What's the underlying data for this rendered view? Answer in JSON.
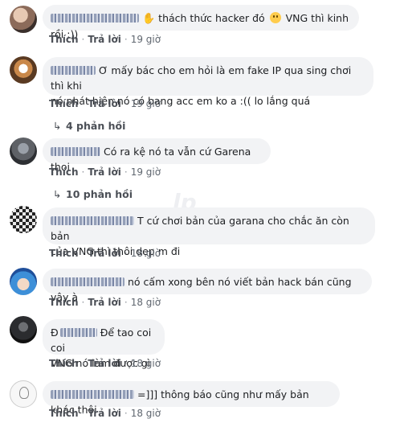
{
  "comments": [
    {
      "author_blurred": true,
      "text_before_emoji": "thách thức hacker đó",
      "text_after_emoji": "VNG thì kinh rồi :))",
      "hand_icon": "waving-hand-icon",
      "smile_icon": "slightly-smiling-face-icon",
      "like": "Thích",
      "reply": "Trả lời",
      "time": "19 giờ"
    },
    {
      "author_blurred": true,
      "line1": "Ơ mấy bác cho em hỏi là em fake IP qua sing chơi thì khi",
      "line2": "nó phát hiện nó có bang acc em ko a :(( lo lắng quá",
      "like": "Thích",
      "reply": "Trả lời",
      "time": "19 giờ",
      "replies": "4 phản hồi"
    },
    {
      "author_blurred": true,
      "line1": "Có ra kệ nó ta vẫn cứ Garena thoi",
      "like": "Thích",
      "reply": "Trả lời",
      "time": "19 giờ",
      "replies": "10 phản hồi"
    },
    {
      "author_blurred": true,
      "line1": "T cứ chơi bản của garana cho chắc ăn còn bản",
      "line2": "của VNG thì thôi dẹp m đi",
      "like": "Thích",
      "reply": "Trả lời",
      "time": "18 giờ"
    },
    {
      "author_blurred": true,
      "line1": "nó cấm xong bên nó viết bản hack bán cũng vậy à",
      "like": "Thích",
      "reply": "Trả lời",
      "time": "18 giờ"
    },
    {
      "author_initial": "Đ",
      "line1": "Để tao coi coi",
      "line2": "VNG nó làm được gì",
      "like": "Thích",
      "reply": "Trả lời",
      "time": "18 giờ"
    },
    {
      "author_blurred": true,
      "line1": "=]]] thông báo cũng như mấy bản khác thôi",
      "like": "Thích",
      "reply": "Trả lời",
      "time": "18 giờ"
    }
  ],
  "colors": {
    "bubble": "#f2f3f5",
    "action_text": "#606770",
    "link_text": "#4b4f56"
  }
}
